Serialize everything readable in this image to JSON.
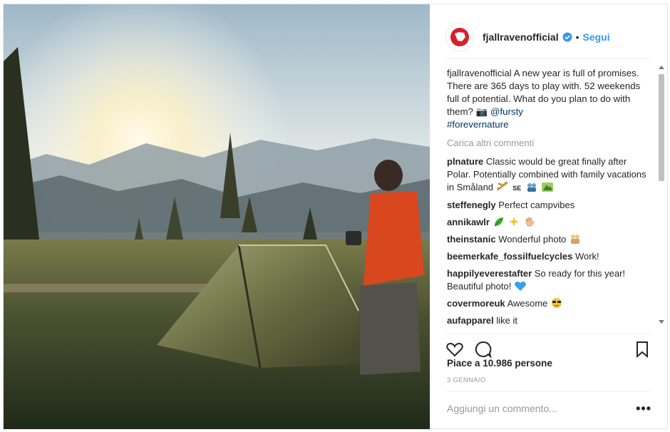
{
  "post": {
    "username": "fjallravenofficial",
    "follow_label": "Segui",
    "separator": "•",
    "photo_alt": "Sunrise over mountains with a green tent and a person in a red jacket holding a mug"
  },
  "caption": {
    "username": "fjallravenofficial",
    "text": "A new year is full of promises. There are 365 days to play with. 52 weekends full of potential. What do you plan to do with them? 📷",
    "mention": "@fursty",
    "hashtag": "#forevernature"
  },
  "load_more_label": "Carica altri commenti",
  "comments": [
    {
      "user": "plnature",
      "text": "Classic would be great finally after Polar. Potentially combined with family vacations in Småland",
      "emojis": [
        "plane-emoji",
        "flag-se-emoji",
        "family-emoji",
        "mountain-emoji"
      ]
    },
    {
      "user": "steffenegly",
      "text": "Perfect campvibes",
      "emojis": []
    },
    {
      "user": "annikawlr",
      "text": "",
      "emojis": [
        "leaf-emoji",
        "sparkles-emoji",
        "hand-emoji"
      ]
    },
    {
      "user": "theinstanic",
      "text": "Wonderful photo",
      "emojis": [
        "couple-emoji"
      ]
    },
    {
      "user": "beemerkafe_fossilfuelcycles",
      "text": "Work!",
      "emojis": []
    },
    {
      "user": "happilyeverestafter",
      "text": "So ready for this year! Beautiful photo!",
      "emojis": [
        "blue-heart-emoji"
      ]
    },
    {
      "user": "covermoreuk",
      "text": "Awesome",
      "emojis": [
        "sunglasses-emoji"
      ]
    },
    {
      "user": "aufapparel",
      "text": "like it",
      "emojis": []
    }
  ],
  "likes_label": "Piace a 10.986 persone",
  "date_label": "3 GENNAIO",
  "comment_input": {
    "placeholder": "Aggiungi un commento..."
  },
  "more_label": "•••",
  "flag_se_text": "SE",
  "colors": {
    "accent": "#3897f0",
    "brand_red": "#d6202c",
    "text": "#262626",
    "muted": "#999999"
  }
}
